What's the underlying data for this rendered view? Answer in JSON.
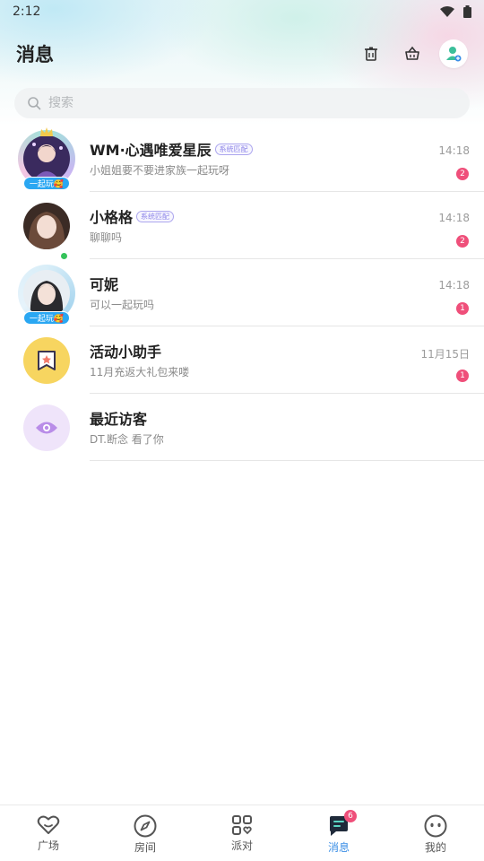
{
  "status_bar": {
    "time": "2:12",
    "icons": [
      "wifi-icon",
      "battery-icon"
    ]
  },
  "header": {
    "title": "消息",
    "actions": [
      "clear-messages-icon",
      "basket-icon",
      "add-friend-icon"
    ]
  },
  "search": {
    "placeholder": "搜索",
    "value": ""
  },
  "conversations": [
    {
      "name": "WM·心遇唯爱星辰",
      "tag": "系统匹配",
      "preview": "小姐姐要不要进家族一起玩呀",
      "time": "14:18",
      "unread": "2",
      "badge": "一起玩🥰",
      "online": false
    },
    {
      "name": "小格格",
      "tag": "系统匹配",
      "preview": "聊聊吗",
      "time": "14:18",
      "unread": "2",
      "badge": "",
      "online": true
    },
    {
      "name": "可妮",
      "tag": "",
      "preview": "可以一起玩吗",
      "time": "14:18",
      "unread": "1",
      "badge": "一起玩🥰",
      "online": false
    },
    {
      "name": "活动小助手",
      "tag": "",
      "preview": "11月充返大礼包来喽",
      "time": "11月15日",
      "unread": "1",
      "badge": "",
      "online": false
    },
    {
      "name": "最近访客",
      "tag": "",
      "preview": "DT.断念 看了你",
      "time": "",
      "unread": "",
      "badge": "",
      "online": false
    }
  ],
  "tabbar": {
    "tabs": [
      {
        "label": "广场",
        "icon": "heart-icon"
      },
      {
        "label": "房间",
        "icon": "compass-icon"
      },
      {
        "label": "派对",
        "icon": "grid-icon"
      },
      {
        "label": "消息",
        "icon": "chat-icon",
        "active": true,
        "badge": "6"
      },
      {
        "label": "我的",
        "icon": "face-icon"
      }
    ]
  },
  "colors": {
    "accent": "#3a8ee6",
    "unread": "#ef4f7a",
    "online": "#35c35a",
    "play_tag": "#2aa7f2"
  }
}
